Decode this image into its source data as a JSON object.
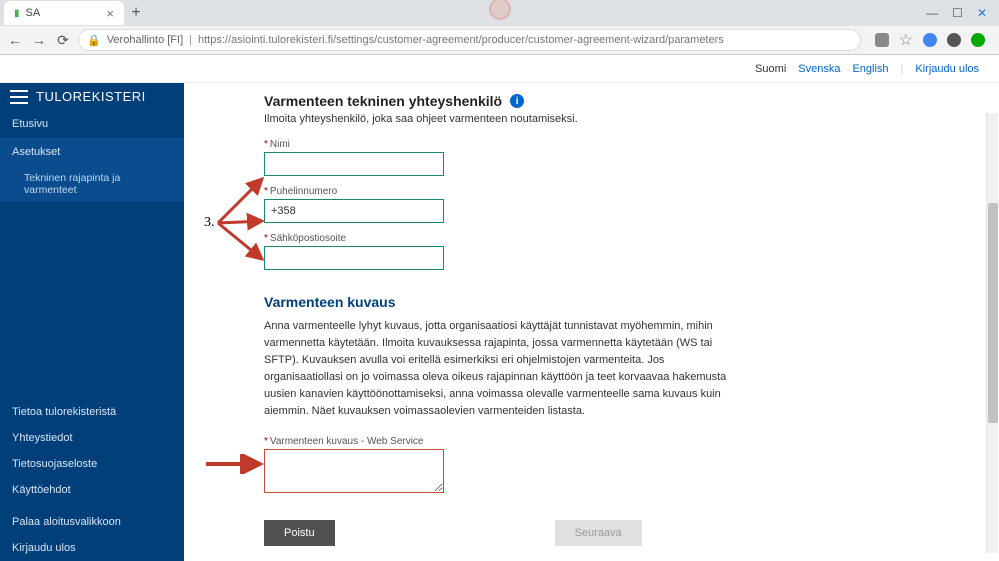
{
  "browser": {
    "tab_title": "SA",
    "url_prefix": "Verohallinto [FI]",
    "url": "https://asiointi.tulorekisteri.fi/settings/customer-agreement/producer/customer-agreement-wizard/parameters"
  },
  "topbar": {
    "lang_fi": "Suomi",
    "lang_sv": "Svenska",
    "lang_en": "English",
    "logout": "Kirjaudu ulos"
  },
  "sidebar": {
    "brand": "TULOREKISTERI",
    "items": {
      "home": "Etusivu",
      "settings": "Asetukset",
      "sub_tech": "Tekninen rajapinta ja varmenteet"
    },
    "footer": {
      "about": "Tietoa tulorekisteristä",
      "contact": "Yhteystiedot",
      "privacy": "Tietosuojaseloste",
      "terms": "Käyttöehdot",
      "back": "Palaa aloitusvalikkoon",
      "logout": "Kirjaudu ulos"
    }
  },
  "content": {
    "section1_title": "Varmenteen tekninen yhteyshenkilö",
    "section1_desc": "Ilmoita yhteyshenkilö, joka saa ohjeet varmenteen noutamiseksi.",
    "field_name_label": "Nimi",
    "field_name_value": "",
    "field_phone_label": "Puhelinnumero",
    "field_phone_value": "+358",
    "field_email_label": "Sähköpostiosoite",
    "field_email_value": "",
    "section2_title": "Varmenteen kuvaus",
    "section2_para": "Anna varmenteelle lyhyt kuvaus, jotta organisaatiosi käyttäjät tunnistavat myöhemmin, mihin varmennetta käytetään. Ilmoita kuvauksessa rajapinta, jossa varmennetta käytetään (WS tai SFTP). Kuvauksen avulla voi eritellä esimerkiksi eri ohjelmistojen varmenteita. Jos organisaatiollasi on jo voimassa oleva oikeus rajapinnan käyttöön ja teet korvaavaa hakemusta uusien kanavien käyttöönottamiseksi, anna voimassa olevalle varmenteelle sama kuvaus kuin aiemmin. Näet kuvauksen voimassaolevien varmenteiden listasta.",
    "field_desc_label": "Varmenteen kuvaus - Web Service",
    "field_desc_value": "",
    "btn_exit": "Poistu",
    "btn_next": "Seuraava"
  },
  "annotation": {
    "number": "3."
  }
}
